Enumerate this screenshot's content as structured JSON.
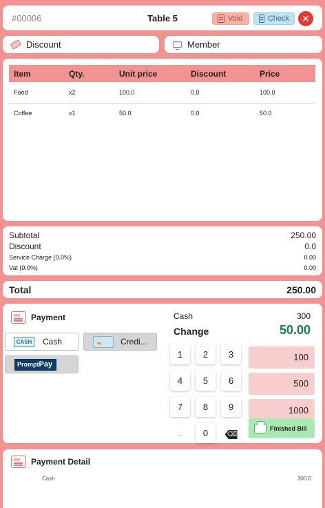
{
  "header": {
    "order_no": "#00006",
    "table": "Table 5",
    "void_label": "Void",
    "check_label": "Check",
    "close_icon": "✕"
  },
  "toolbar": {
    "discount_label": "Discount",
    "member_label": "Member"
  },
  "items": {
    "columns": [
      "Item",
      "Qty.",
      "Unit price",
      "Discount",
      "Price"
    ],
    "rows": [
      [
        "Food",
        "x2",
        "100.0",
        "0.0",
        "100.0"
      ],
      [
        "Coffee",
        "x1",
        "50.0",
        "0.0",
        "50.0"
      ]
    ]
  },
  "summary": {
    "subtotal_label": "Subtotal",
    "subtotal_value": "250.00",
    "discount_label": "Discount",
    "discount_value": "0.0",
    "service_label": "Service Charge (0.0%)",
    "service_value": "0.00",
    "vat_label": "Vat (0.0%)",
    "vat_value": "0.00"
  },
  "total": {
    "label": "Total",
    "value": "250.00"
  },
  "payment": {
    "title": "Payment",
    "methods": {
      "cash": {
        "label": "Cash",
        "logo": "CASH"
      },
      "credit": {
        "label": "Credi..."
      },
      "promptpay": {
        "logo_a": "Prompt",
        "logo_b": "Pay"
      }
    },
    "cash_label": "Cash",
    "cash_value": "300",
    "change_label": "Change",
    "change_value": "50.00",
    "keypad": [
      "1",
      "2",
      "3",
      "4",
      "5",
      "6",
      "7",
      "8",
      "9",
      ".",
      "0",
      "⌫"
    ],
    "quick_amounts": [
      "100",
      "500",
      "1000"
    ],
    "finish_label": "Finished Bill"
  },
  "payment_detail": {
    "title": "Payment Detail",
    "rows": [
      {
        "method": "Cash",
        "amount": "300.0"
      }
    ]
  },
  "colors": {
    "background": "#f19393",
    "change_value": "#1a7a52",
    "close": "#e53935",
    "finish": "#a9e8b0"
  }
}
